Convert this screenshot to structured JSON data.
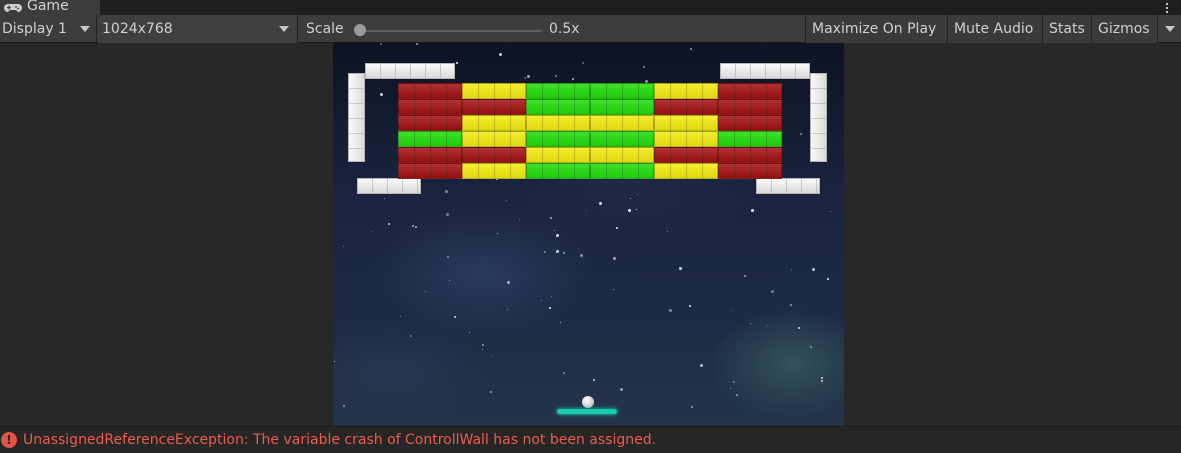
{
  "tab": {
    "icon": "gamepad-icon",
    "label": "Game"
  },
  "toolbar": {
    "display": "Display 1",
    "resolution": "1024x768",
    "scale_label": "Scale",
    "scale_value": "0.5x",
    "scale_fraction": 0.0,
    "maximize": "Maximize On Play",
    "mute": "Mute Audio",
    "stats": "Stats",
    "gizmos": "Gizmos"
  },
  "game": {
    "brick_colors": {
      "R": "#a10f0f",
      "Y": "#f1ea0f",
      "G": "#1fdb0a"
    },
    "brick_rows": [
      [
        "R",
        "Y",
        "G",
        "G",
        "Y",
        "R"
      ],
      [
        "R",
        "R",
        "G",
        "G",
        "R",
        "R"
      ],
      [
        "R",
        "Y",
        "Y",
        "Y",
        "Y",
        "R"
      ],
      [
        "G",
        "Y",
        "G",
        "G",
        "Y",
        "G"
      ],
      [
        "R",
        "R",
        "Y",
        "Y",
        "R",
        "R"
      ],
      [
        "R",
        "Y",
        "G",
        "G",
        "Y",
        "R"
      ]
    ]
  },
  "status": {
    "icon": "error-icon",
    "message": "UnassignedReferenceException: The variable crash of ControllWall has not been assigned."
  }
}
